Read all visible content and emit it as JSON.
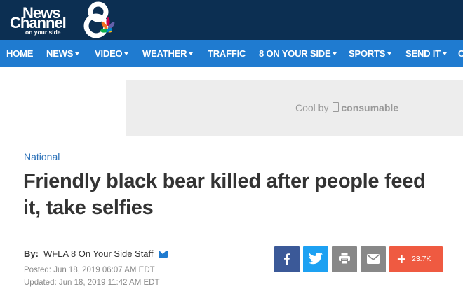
{
  "header": {
    "logo": {
      "line1": "News",
      "line2": "Channel",
      "line3": "on your side",
      "number": "8"
    }
  },
  "nav": {
    "items": [
      {
        "label": "HOME",
        "dropdown": false
      },
      {
        "label": "NEWS",
        "dropdown": true
      },
      {
        "label": "VIDEO",
        "dropdown": true
      },
      {
        "label": "WEATHER",
        "dropdown": true
      },
      {
        "label": "TRAFFIC",
        "dropdown": false
      },
      {
        "label": "8 ON YOUR SIDE",
        "dropdown": true
      },
      {
        "label": "SPORTS",
        "dropdown": true
      },
      {
        "label": "SEND IT",
        "dropdown": true
      }
    ]
  },
  "ad": {
    "prefix": "Cool by",
    "brand": "consumable"
  },
  "article": {
    "category": "National",
    "headline": "Friendly black bear killed after people feed it, take selfies",
    "byline_label": "By:",
    "author": "WFLA 8 On Your Side Staff",
    "posted": "Posted: Jun 18, 2019 06:07 AM EDT",
    "updated": "Updated: Jun 18, 2019 11:42 AM EDT"
  },
  "share": {
    "count": "23.7K",
    "plus": "+"
  },
  "colors": {
    "header_bg": "#0c2f52",
    "nav_bg": "#1f7bd0",
    "facebook": "#3b5998",
    "twitter": "#1da1f2",
    "print": "#888888",
    "email": "#888888",
    "more": "#ef5a41",
    "category_link": "#2a70b8"
  }
}
